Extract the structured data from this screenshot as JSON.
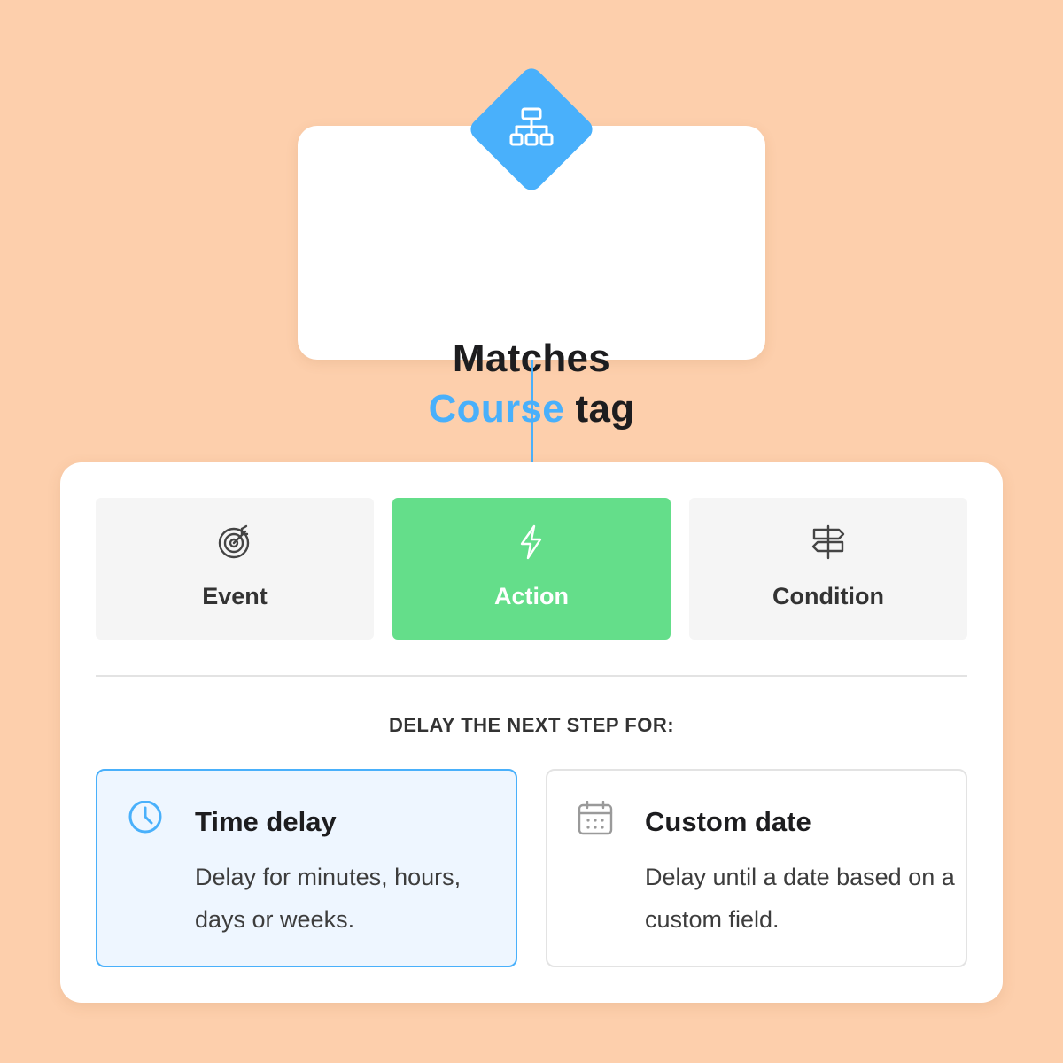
{
  "trigger": {
    "icon": "sitemap-icon",
    "line1": "Matches",
    "line2_accent": "Course",
    "line2_rest": "tag",
    "accent_color": "#49b0fb"
  },
  "step_types": [
    {
      "label": "Event",
      "icon": "target-icon",
      "selected": false
    },
    {
      "label": "Action",
      "icon": "lightning-icon",
      "selected": true
    },
    {
      "label": "Condition",
      "icon": "signpost-icon",
      "selected": false
    }
  ],
  "delay_section": {
    "heading": "DELAY THE NEXT STEP FOR:",
    "options": [
      {
        "title": "Time delay",
        "description": "Delay for minutes, hours, days or weeks.",
        "icon": "clock-icon",
        "selected": true
      },
      {
        "title": "Custom date",
        "description": "Delay until a date based on a custom field.",
        "icon": "calendar-icon",
        "selected": false
      }
    ]
  },
  "colors": {
    "background": "#fdcfac",
    "accent_blue": "#49b0fb",
    "action_green": "#64de8a"
  }
}
